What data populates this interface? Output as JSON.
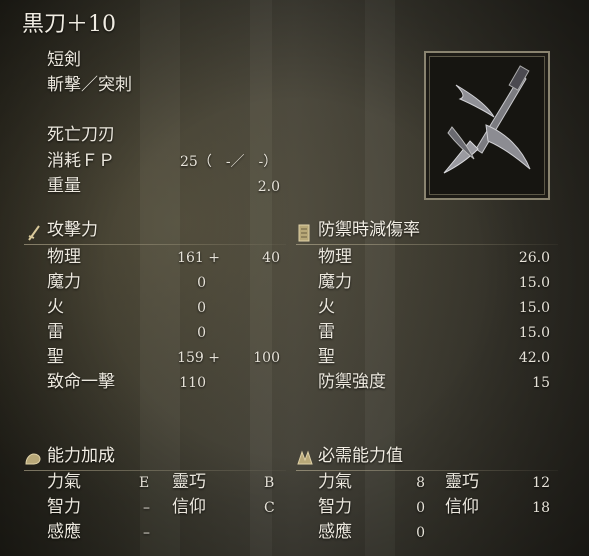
{
  "item": {
    "name": "黒刀＋10",
    "type": "短剣",
    "attack_type": "斬撃／突刺",
    "skill": "死亡刀刃",
    "fp_cost_label": "消耗ＦＰ",
    "fp_cost_value": "25（　-／　-）",
    "weight_label": "重量",
    "weight_value": "2.0"
  },
  "attack": {
    "title": "攻擊力",
    "rows": [
      {
        "label": "物理",
        "base": "161 +",
        "bonus": "40"
      },
      {
        "label": "魔力",
        "base": "0",
        "bonus": ""
      },
      {
        "label": "火",
        "base": "0",
        "bonus": ""
      },
      {
        "label": "雷",
        "base": "0",
        "bonus": ""
      },
      {
        "label": "聖",
        "base": "159 +",
        "bonus": "100"
      },
      {
        "label": "致命一擊",
        "base": "110",
        "bonus": ""
      }
    ]
  },
  "guard": {
    "title": "防禦時減傷率",
    "rows": [
      {
        "label": "物理",
        "value": "26.0"
      },
      {
        "label": "魔力",
        "value": "15.0"
      },
      {
        "label": "火",
        "value": "15.0"
      },
      {
        "label": "雷",
        "value": "15.0"
      },
      {
        "label": "聖",
        "value": "42.0"
      },
      {
        "label": "防禦強度",
        "value": "15"
      }
    ]
  },
  "scaling": {
    "title": "能力加成",
    "rows": [
      {
        "l1": "力氣",
        "v1": "E",
        "l2": "靈巧",
        "v2": "B"
      },
      {
        "l1": "智力",
        "v1": "–",
        "l2": "信仰",
        "v2": "C"
      },
      {
        "l1": "感應",
        "v1": "–",
        "l2": "",
        "v2": ""
      }
    ]
  },
  "requirements": {
    "title": "必需能力值",
    "rows": [
      {
        "l1": "力氣",
        "v1": "8",
        "l2": "靈巧",
        "v2": "12"
      },
      {
        "l1": "智力",
        "v1": "0",
        "l2": "信仰",
        "v2": "18"
      },
      {
        "l1": "感應",
        "v1": "0",
        "l2": "",
        "v2": ""
      }
    ]
  },
  "icons": {
    "weapon_image": "black-knife-icon",
    "attack": "sword-icon",
    "guard": "shield-icon",
    "scaling": "arm-icon",
    "requirements": "hands-icon"
  }
}
